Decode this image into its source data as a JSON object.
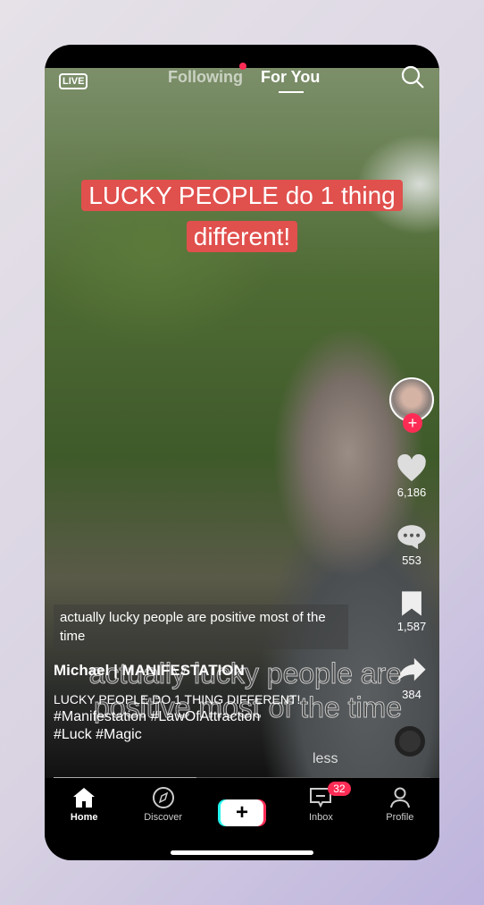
{
  "header": {
    "live": "LIVE",
    "tabs": [
      "Following",
      "For You"
    ],
    "active_tab": "For You"
  },
  "video": {
    "headline_line1": "LUCKY PEOPLE do 1 thing",
    "headline_line2": "different!",
    "caption": "actually lucky people are positive most of the time",
    "overlay_text": "actually lucky people are positive most of the time",
    "author": "Michael | MANIFESTATION",
    "description": "LUCKY PEOPLE DO 1 THING DIFFERENT!",
    "hashtags1": "#Manifestation #LawOfAttraction",
    "hashtags2": "#Luck #Magic",
    "less": "less",
    "progress": 0.38
  },
  "actions": {
    "likes": "6,186",
    "comments": "553",
    "saves": "1,587",
    "shares": "384"
  },
  "nav": {
    "items": [
      "Home",
      "Discover",
      "",
      "Inbox",
      "Profile"
    ],
    "create": "+",
    "inbox_badge": "32"
  },
  "colors": {
    "accent": "#fe2c55",
    "headline_bg": "#e0504d"
  }
}
